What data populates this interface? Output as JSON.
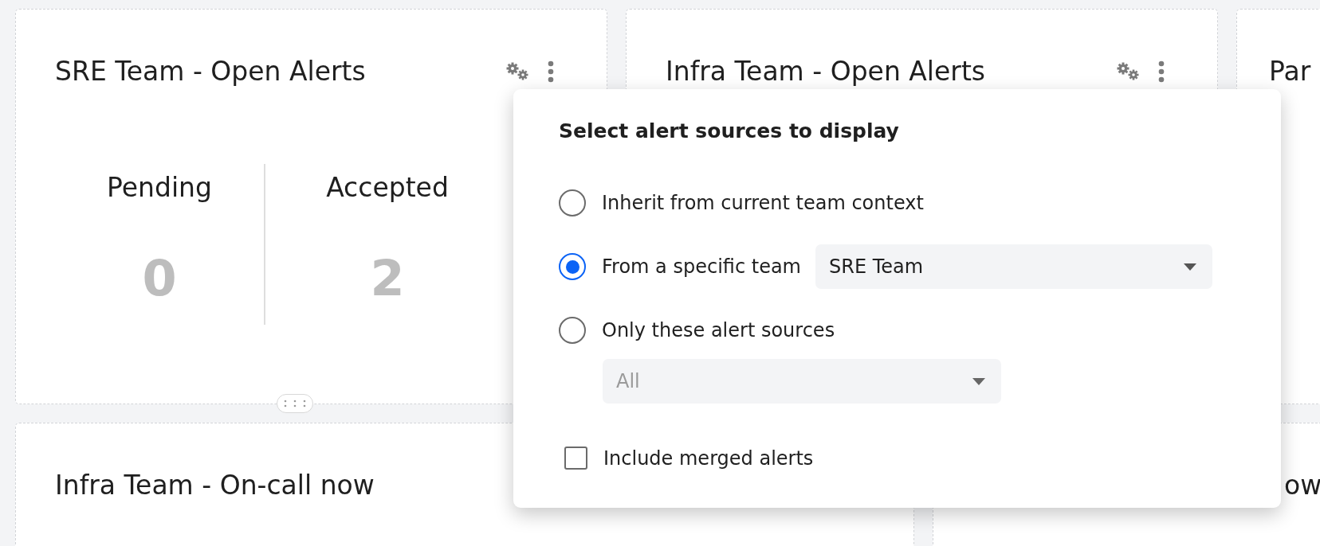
{
  "top_cards": [
    {
      "title": "SRE Team - Open Alerts",
      "icons": true,
      "handle": true,
      "stats": [
        {
          "label": "Pending",
          "value": "0"
        },
        {
          "label": "Accepted",
          "value": "2"
        }
      ]
    },
    {
      "title": "Infra Team - Open Alerts",
      "icons": true,
      "handle": false
    },
    {
      "title": "Par",
      "icons": false
    }
  ],
  "bottom_cards": [
    {
      "title": "Infra Team - On-call now"
    },
    {
      "title": "ow"
    }
  ],
  "popup": {
    "heading": "Select alert sources to display",
    "options": [
      {
        "kind": "plain",
        "label": "Inherit from current team context",
        "selected": false
      },
      {
        "kind": "team_select",
        "label": "From a specific team",
        "selected": true,
        "value": "SRE Team",
        "disabled": false
      },
      {
        "kind": "source_select",
        "label": "Only these alert sources",
        "selected": false,
        "value": "All",
        "disabled": true
      }
    ],
    "include_merged": {
      "label": "Include merged alerts",
      "checked": false
    }
  }
}
